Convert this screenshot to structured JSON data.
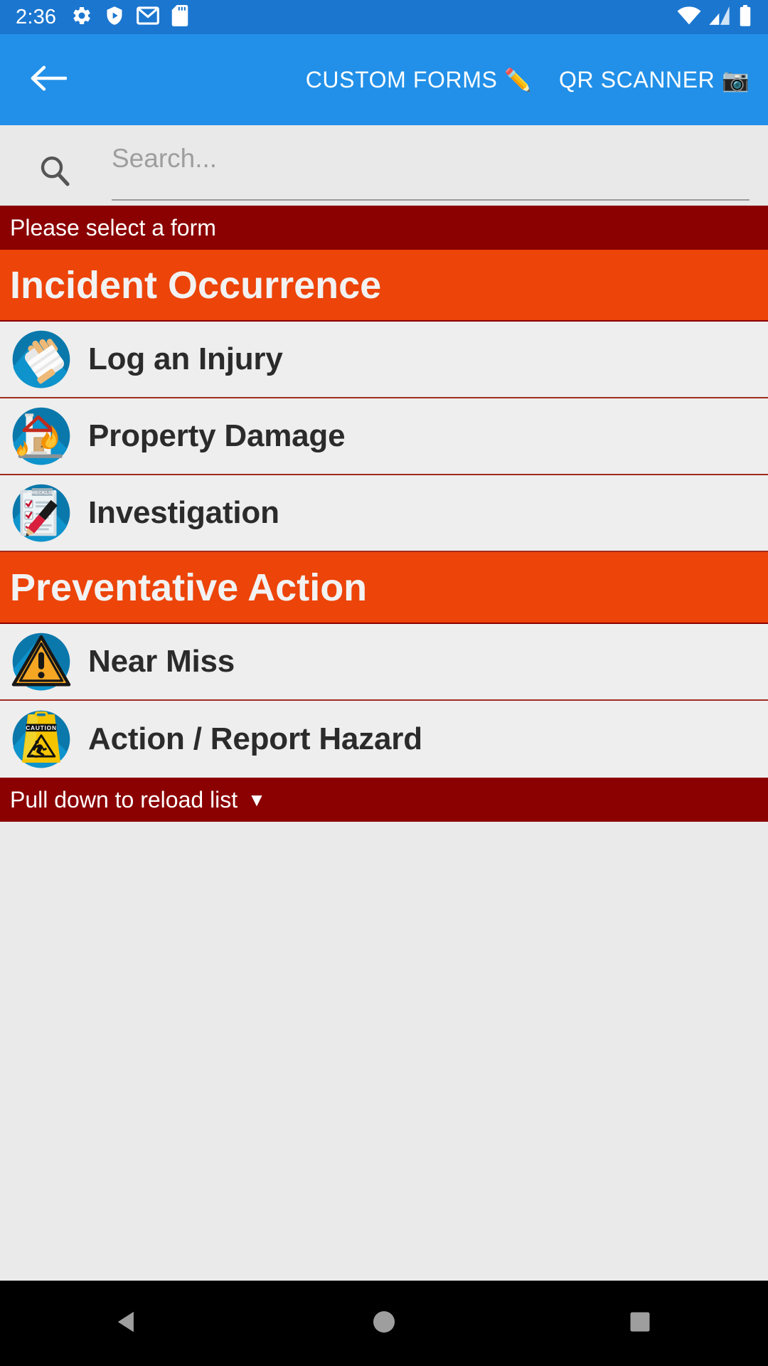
{
  "status_bar": {
    "time": "2:36",
    "left_icons": [
      "settings-gear-icon",
      "play-protect-shield-icon",
      "gmail-icon",
      "sd-card-icon"
    ],
    "right_icons": [
      "wifi-icon",
      "cellular-signal-icon",
      "battery-icon"
    ],
    "background_color": "#1b76cf"
  },
  "app_bar": {
    "back_icon": "back-arrow-icon",
    "background_color": "#2290e8",
    "actions": [
      {
        "label": "CUSTOM FORMS",
        "emoji": "✏️",
        "icon": "pencil-icon"
      },
      {
        "label": "QR SCANNER",
        "emoji": "📷",
        "icon": "camera-icon"
      }
    ]
  },
  "search": {
    "icon": "search-icon",
    "placeholder": "Search...",
    "value": ""
  },
  "banners": {
    "select_form": "Please select a form",
    "reload_hint": "Pull down to reload list",
    "reload_arrow": "▼",
    "color": "#8b0000"
  },
  "colors": {
    "section_header": "#ec4409",
    "row_background": "#eeeeee",
    "row_divider": "#a12b1e",
    "page_background": "#eaeaea",
    "accent_blue": "#1b76cf"
  },
  "sections": [
    {
      "title": "Incident Occurrence",
      "items": [
        {
          "label": "Log an Injury",
          "icon": "bandaged-hand-icon"
        },
        {
          "label": "Property Damage",
          "icon": "burning-house-icon"
        },
        {
          "label": "Investigation",
          "icon": "checklist-pencil-icon"
        }
      ]
    },
    {
      "title": "Preventative Action",
      "items": [
        {
          "label": "Near Miss",
          "icon": "warning-triangle-icon"
        },
        {
          "label": "Action / Report Hazard",
          "icon": "caution-wet-floor-sign-icon"
        }
      ]
    }
  ],
  "nav_bar": {
    "buttons": [
      {
        "name": "back-nav-button",
        "icon": "triangle-back-icon"
      },
      {
        "name": "home-nav-button",
        "icon": "circle-home-icon"
      },
      {
        "name": "recents-nav-button",
        "icon": "square-recents-icon"
      }
    ]
  }
}
